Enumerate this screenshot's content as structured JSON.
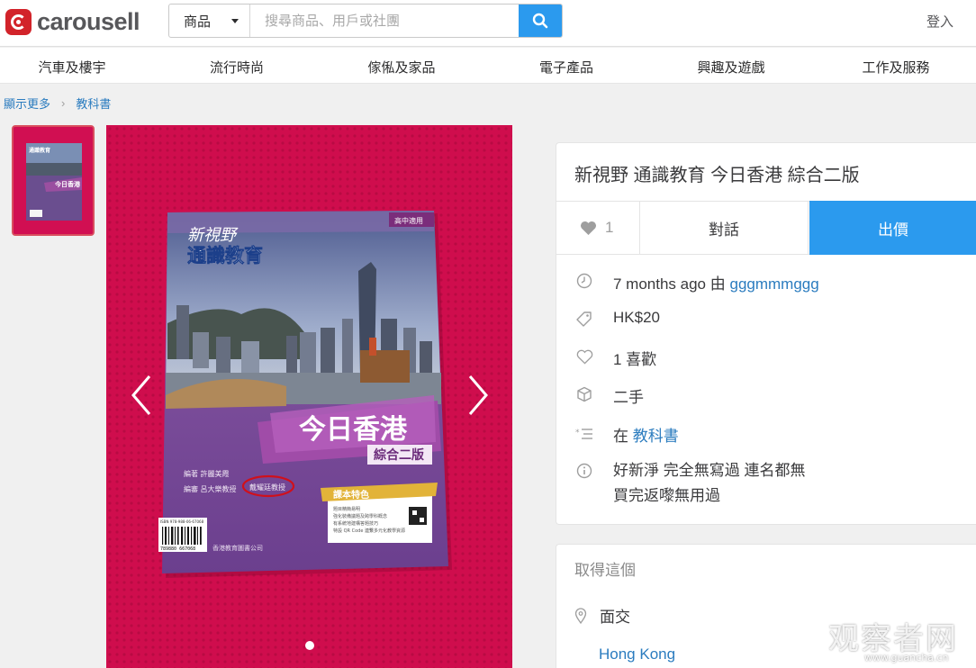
{
  "header": {
    "logo_text": "carousell",
    "search_category": "商品",
    "search_placeholder": "搜尋商品、用戶或社團",
    "login_label": "登入"
  },
  "categories": [
    "汽車及樓宇",
    "流行時尚",
    "傢俬及家品",
    "電子產品",
    "興趣及遊戲",
    "工作及服務"
  ],
  "breadcrumb": {
    "home": "顯示更多",
    "current": "教科書"
  },
  "book": {
    "corner_tag": "高中適用",
    "brand_line1": "新視野",
    "brand_line2": "通識教育",
    "main_title": "今日香港",
    "edition": "綜合二版",
    "credits_line1": "編著  許麗美霞",
    "credits_line2": "編審  呂大樂教授",
    "circled_name": "戴耀廷教授",
    "features_title": "課本特色",
    "features": [
      "題目精簡易明",
      "強化裝備議題及跨學科概念",
      "有系統地建構答題技巧",
      "特設 QR Code 連繫多元化教學資源"
    ],
    "isbn": "ISBN 978-988-06-67068",
    "barcode_number": "789880 667068",
    "publisher": "香港教育圖書公司",
    "image_count": 1
  },
  "listing": {
    "title": "新視野 通識教育 今日香港 綜合二版",
    "likes": "1",
    "chat_label": "對話",
    "offer_label": "出價",
    "posted_time": "7 months ago",
    "posted_by_prefix": "由",
    "seller": "gggmmmggg",
    "price": "HK$20",
    "likes_text": "1 喜歡",
    "condition": "二手",
    "category_prefix": "在",
    "category": "教科書",
    "description_line1": "好新淨 完全無寫過 連名都無",
    "description_line2": "買完返嚟無用過"
  },
  "delivery": {
    "section_title": "取得這個",
    "method": "面交",
    "location": "Hong Kong"
  },
  "watermark": {
    "main": "观察者网",
    "sub": "www.guancha.cn"
  },
  "colors": {
    "brand_red": "#d2232a",
    "accent_blue": "#2b9aee",
    "link_blue": "#2b7cbf",
    "mat_pink": "#cf0d4d"
  },
  "icons": [
    "search-icon",
    "heart-icon",
    "clock-icon",
    "price-tag-icon",
    "heart-outline-icon",
    "box-icon",
    "category-list-icon",
    "info-icon",
    "location-pin-icon",
    "chevron-left-icon",
    "chevron-right-icon"
  ]
}
